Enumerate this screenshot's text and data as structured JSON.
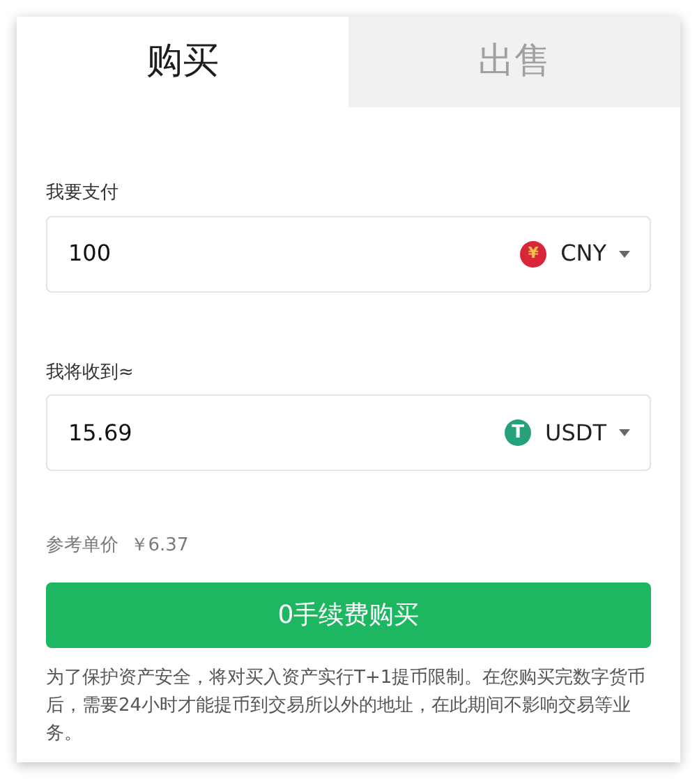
{
  "tabs": [
    {
      "label": "购买",
      "selected": true
    },
    {
      "label": "出售",
      "selected": false
    }
  ],
  "fields": [
    {
      "label": "我要支付",
      "value": "100",
      "currency": "CNY",
      "kind": "cny",
      "coin_symbol": "¥"
    },
    {
      "label": "我将收到≈",
      "value": "15.69",
      "currency": "USDT",
      "kind": "usdt",
      "coin_symbol": "T"
    }
  ],
  "reference_price": {
    "label": "参考单价",
    "value": "￥6.37"
  },
  "submit_button": "0手续费购买",
  "notice": "为了保护资产安全，将对买入资产实行T+1提币限制。在您购买完数字货币后，需要24小时才能提币到交易所以外的地址，在此期间不影响交易等业务。"
}
